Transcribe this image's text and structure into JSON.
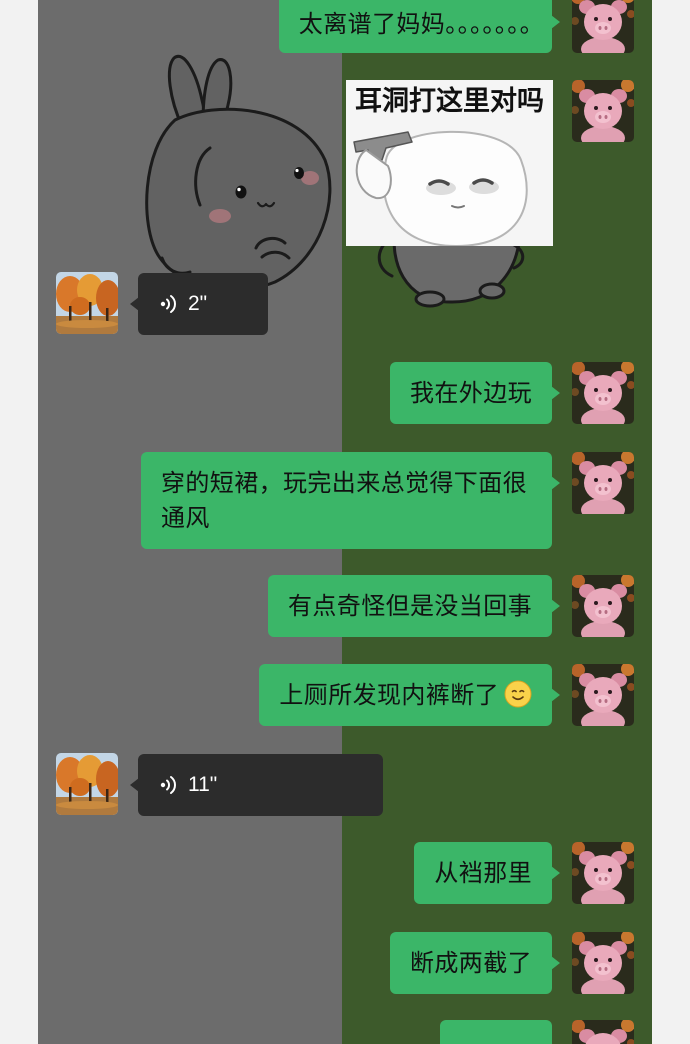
{
  "colors": {
    "page_bg": "#f2f2f2",
    "chat_bg_left": "#6c6c6c",
    "chat_bg_right": "#3d5a2b",
    "sent_bubble": "#3bb668",
    "sent_text": "#111111",
    "received_bubble": "#2c2c2c",
    "received_text": "#ffffff"
  },
  "avatars": {
    "self": "pink-pig-avatar",
    "contact": "autumn-trees-avatar"
  },
  "wallpaper": "bunny-cartoon-wallpaper",
  "messages": [
    {
      "side": "right",
      "type": "text",
      "text": "太离谱了妈妈。。。。。。。"
    },
    {
      "side": "right",
      "type": "sticker",
      "caption": "耳洞打这里对吗"
    },
    {
      "side": "left",
      "type": "voice",
      "duration": "2\""
    },
    {
      "side": "right",
      "type": "text",
      "text": "我在外边玩"
    },
    {
      "side": "right",
      "type": "text",
      "text": "穿的短裙，玩完出来总觉得下面很通风"
    },
    {
      "side": "right",
      "type": "text",
      "text": "有点奇怪但是没当回事"
    },
    {
      "side": "right",
      "type": "text",
      "text": "上厕所发现内裤断了",
      "emoji": "smile-emoji-icon"
    },
    {
      "side": "left",
      "type": "voice",
      "duration": "11\""
    },
    {
      "side": "right",
      "type": "text",
      "text": "从裆那里"
    },
    {
      "side": "right",
      "type": "text",
      "text": "断成两截了"
    },
    {
      "side": "right",
      "type": "text"
    }
  ]
}
